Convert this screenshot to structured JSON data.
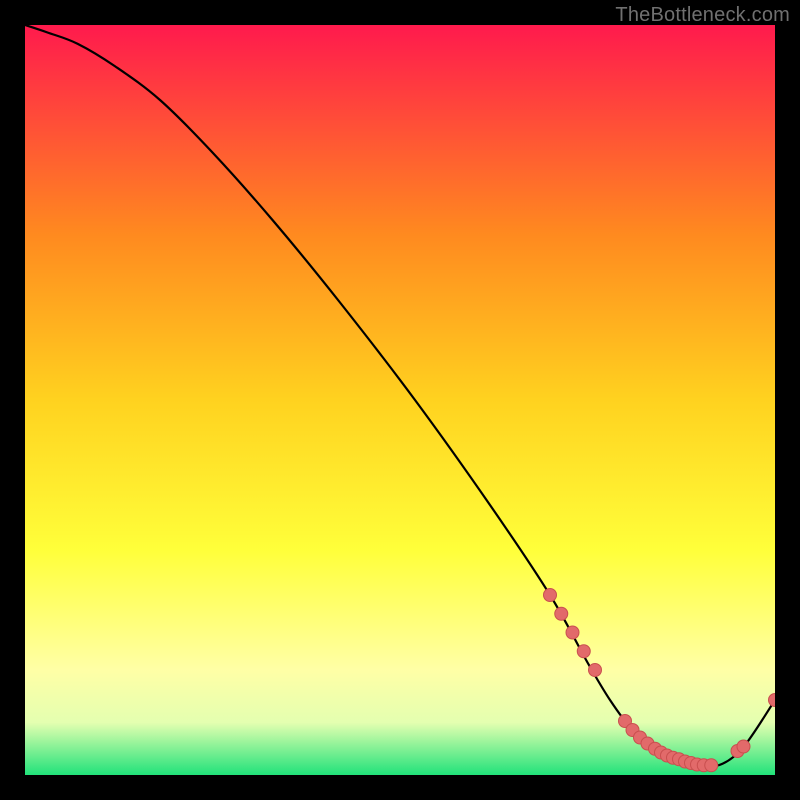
{
  "watermark": "TheBottleneck.com",
  "colors": {
    "page_bg": "#000000",
    "grad_top": "#ff1a4d",
    "grad_mid_upper": "#ff8a1f",
    "grad_mid": "#ffd21f",
    "grad_mid_lower": "#ffff3a",
    "grad_light_yellow": "#ffffa6",
    "grad_pale": "#e4ffb0",
    "grad_green": "#21e27a",
    "curve": "#000000",
    "marker_fill": "#e26a6a",
    "marker_stroke": "#c94f4f"
  },
  "chart_data": {
    "type": "line",
    "title": "",
    "xlabel": "",
    "ylabel": "",
    "xlim": [
      0,
      100
    ],
    "ylim": [
      0,
      100
    ],
    "series": [
      {
        "name": "curve",
        "x": [
          0,
          3,
          7,
          12,
          18,
          25,
          33,
          42,
          52,
          62,
          70,
          75,
          78,
          81,
          84,
          87,
          90,
          93,
          96,
          100
        ],
        "y": [
          100,
          99,
          97.5,
          94.5,
          90,
          83,
          74,
          63,
          50,
          36,
          24,
          15,
          10,
          6,
          3.5,
          2,
          1.2,
          1.5,
          4,
          10
        ]
      }
    ],
    "markers": {
      "name": "highlight-points",
      "x": [
        70,
        71.5,
        73,
        74.5,
        76,
        80,
        81,
        82,
        83,
        84,
        84.8,
        85.6,
        86.4,
        87.2,
        88,
        88.8,
        89.6,
        90.5,
        91.5,
        95,
        95.8,
        100
      ],
      "y": [
        24,
        21.5,
        19,
        16.5,
        14,
        7.2,
        6,
        5,
        4.2,
        3.5,
        3,
        2.6,
        2.3,
        2.1,
        1.8,
        1.6,
        1.4,
        1.3,
        1.3,
        3.2,
        3.8,
        10
      ]
    }
  }
}
